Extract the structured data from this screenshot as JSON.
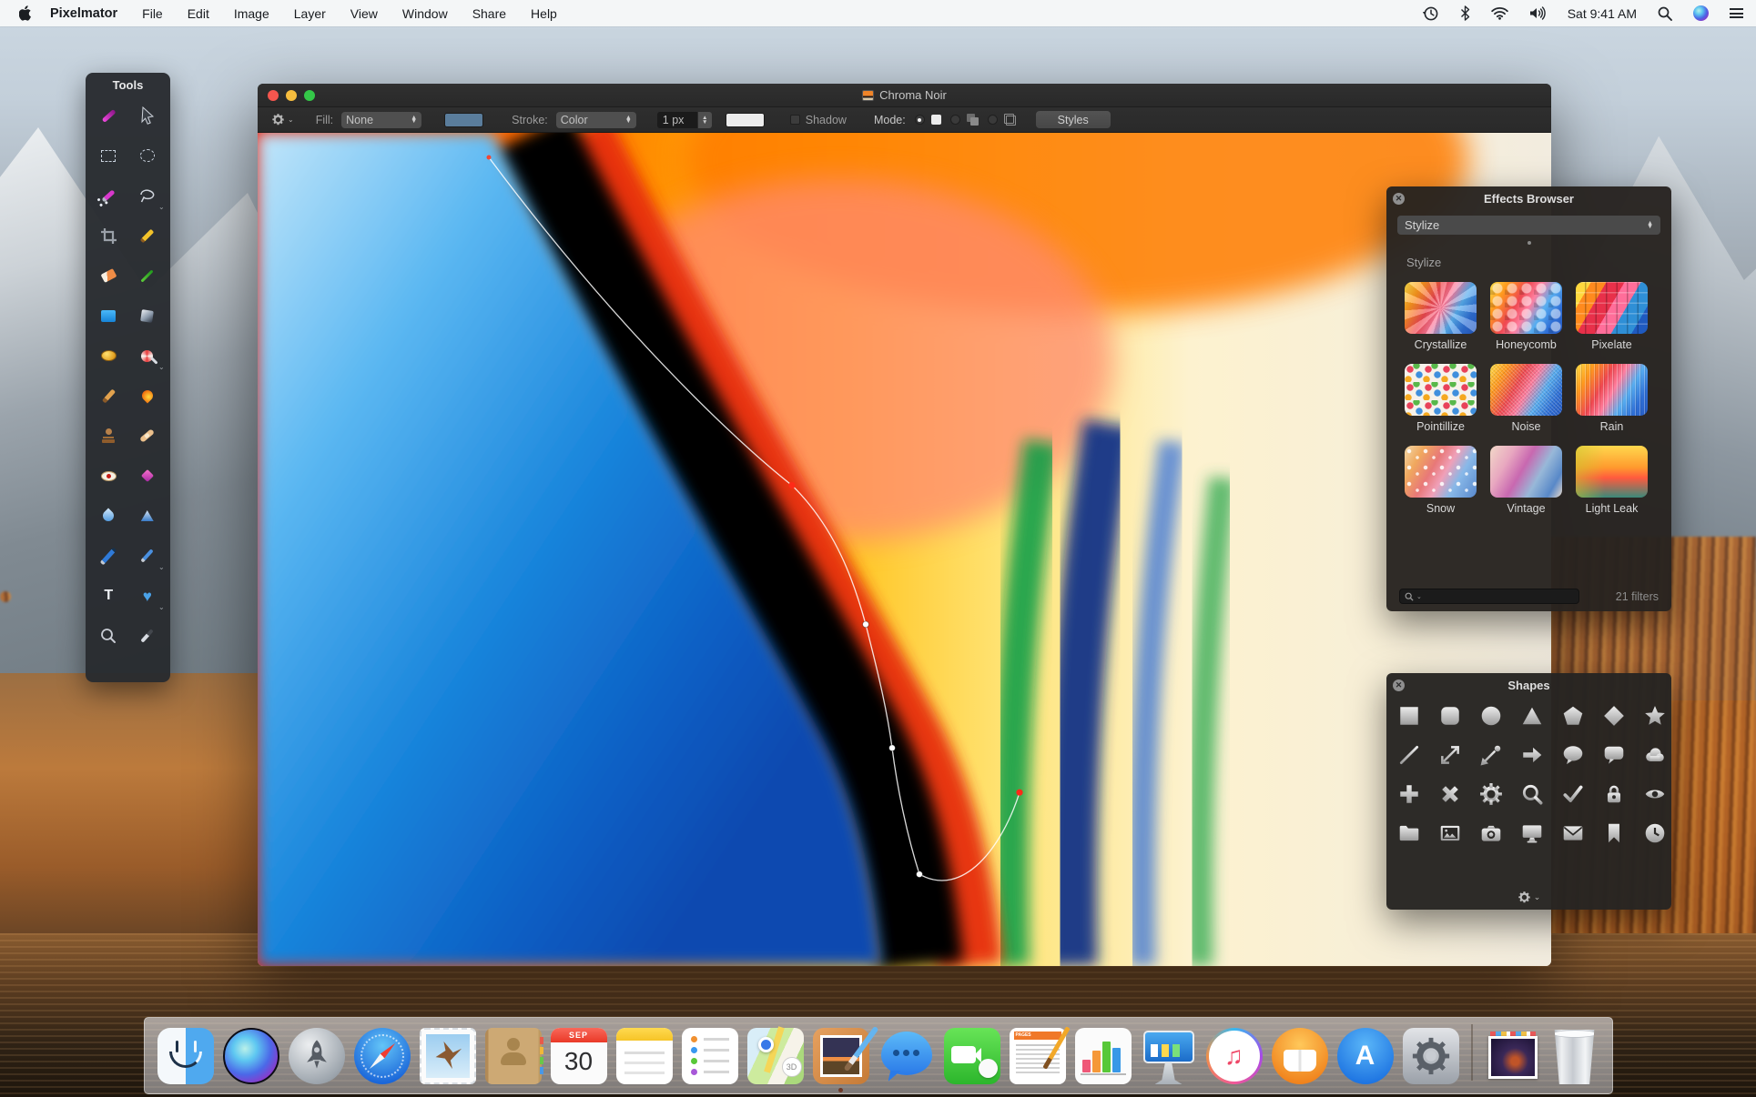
{
  "menu_bar": {
    "app_name": "Pixelmator",
    "items": [
      "File",
      "Edit",
      "Image",
      "Layer",
      "View",
      "Window",
      "Share",
      "Help"
    ],
    "clock": "Sat 9:41 AM",
    "status_icons": [
      "time-machine",
      "bluetooth",
      "wifi",
      "volume",
      "spotlight",
      "siri",
      "notification-center"
    ]
  },
  "tools_panel": {
    "title": "Tools",
    "tools": [
      "move",
      "arrow",
      "rectangular-marquee",
      "elliptical-marquee",
      "magic-wand",
      "lasso",
      "crop",
      "pencil",
      "eraser",
      "line",
      "paint-bucket",
      "gradient",
      "dodge",
      "color-brush",
      "brush",
      "burn",
      "clone-stamp",
      "heal",
      "red-eye",
      "sparkle",
      "blur",
      "sharpen",
      "pen",
      "freeform-pen",
      "type",
      "shapes",
      "zoom",
      "eyedropper"
    ]
  },
  "document_window": {
    "title": "Chroma Noir",
    "toolbar": {
      "fill_label": "Fill:",
      "fill_value": "None",
      "fill_swatch_color": "#5a7d9c",
      "stroke_label": "Stroke:",
      "stroke_value": "Color",
      "stroke_width": "1 px",
      "stroke_swatch_color": "#ececec",
      "shadow_label": "Shadow",
      "mode_label": "Mode:",
      "styles_button": "Styles"
    }
  },
  "effects_browser": {
    "title": "Effects Browser",
    "category_value": "Stylize",
    "section_title": "Stylize",
    "effects": [
      {
        "name": "Crystallize"
      },
      {
        "name": "Honeycomb"
      },
      {
        "name": "Pixelate"
      },
      {
        "name": "Pointillize"
      },
      {
        "name": "Noise"
      },
      {
        "name": "Rain"
      },
      {
        "name": "Snow"
      },
      {
        "name": "Vintage"
      },
      {
        "name": "Light Leak"
      }
    ],
    "filter_count": "21 filters"
  },
  "shapes_panel": {
    "title": "Shapes",
    "shapes": [
      "square",
      "rounded-square",
      "circle",
      "triangle",
      "pentagon",
      "diamond",
      "star",
      "line",
      "double-arrow",
      "connector",
      "arrow",
      "speech-bubble",
      "rectangular-callout",
      "cloud",
      "plus",
      "cross",
      "gear",
      "magnifying-glass",
      "checkmark",
      "lock",
      "eye",
      "folder",
      "picture",
      "camera",
      "display",
      "envelope",
      "bookmark",
      "clock"
    ]
  },
  "dock": {
    "apps": [
      "Finder",
      "Siri",
      "Launchpad",
      "Safari",
      "Mail",
      "Contacts",
      "Calendar",
      "Notes",
      "Reminders",
      "Maps",
      "Pixelmator",
      "Messages",
      "FaceTime",
      "Pages",
      "Numbers",
      "Keynote",
      "iTunes",
      "iBooks",
      "App Store",
      "System Preferences",
      "Desktop Pictures",
      "Trash"
    ],
    "calendar_month": "SEP",
    "calendar_day": "30",
    "maps_badge": "3D",
    "pages_header": "PAGES"
  },
  "colors": {
    "traffic_red": "#f5564e",
    "traffic_yellow": "#f6bd3e",
    "traffic_green": "#34c748",
    "panel_bg": "#262220",
    "accent_blue": "#2e7de8"
  }
}
